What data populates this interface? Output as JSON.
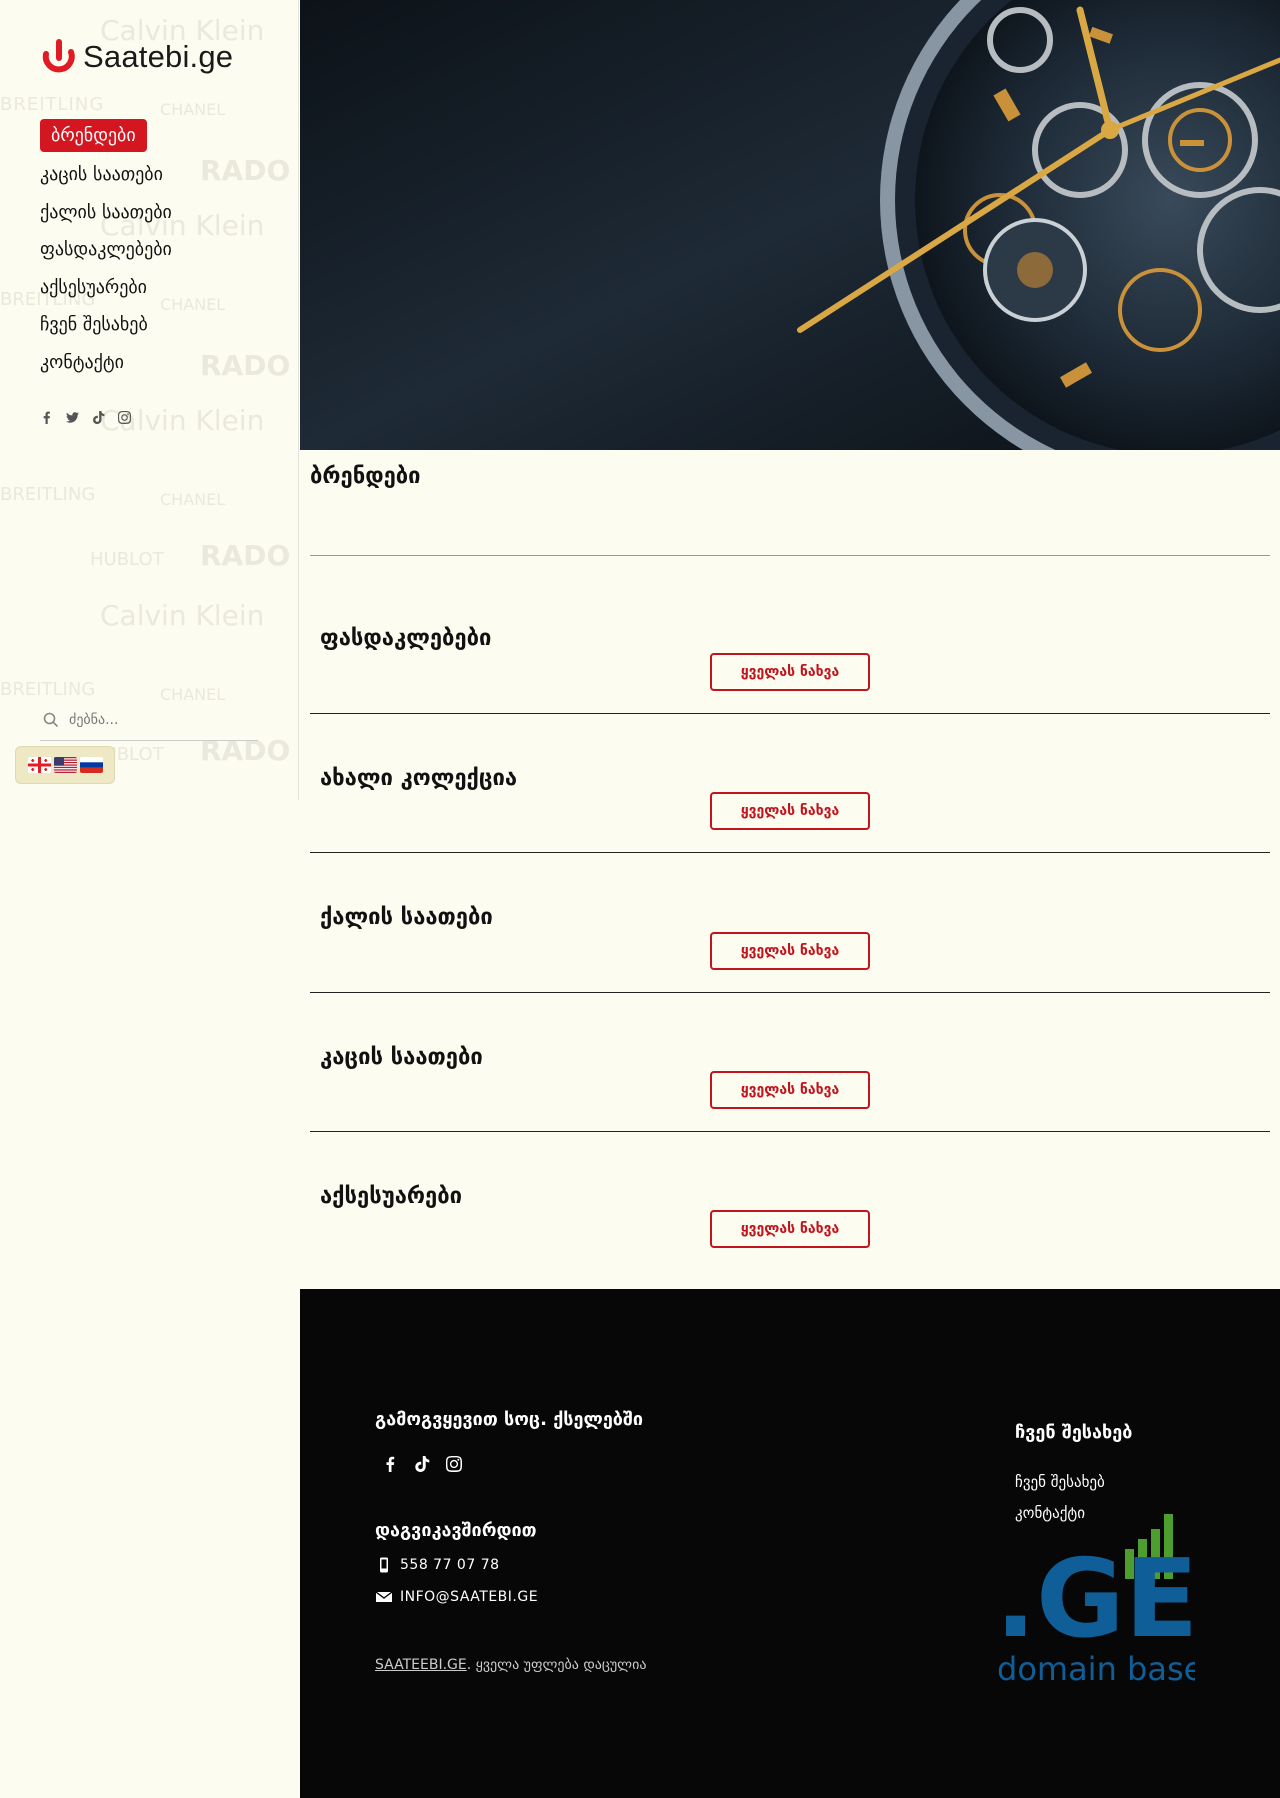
{
  "site": {
    "logo_text": "Saatebi.ge",
    "brand_color": "#d31620"
  },
  "sidebar": {
    "nav_items": [
      {
        "label": "ბრენდები",
        "active": true
      },
      {
        "label": "კაცის საათები"
      },
      {
        "label": "ქალის საათები"
      },
      {
        "label": "ფასდაკლებები"
      },
      {
        "label": "აქსესუარები"
      },
      {
        "label": "ჩვენ შესახებ"
      },
      {
        "label": "კონტაქტი"
      }
    ],
    "social_icons": [
      "facebook-icon",
      "twitter-icon",
      "tiktok-icon",
      "instagram-icon"
    ],
    "search_placeholder": "ძებნა...",
    "languages": [
      "georgian-flag",
      "us-flag",
      "russian-flag"
    ],
    "background_brands": [
      "Calvin Klein",
      "BREITLING",
      "CHANEL",
      "RADO",
      "HUBLOT"
    ]
  },
  "main": {
    "page_title": "ბრენდები",
    "sections": [
      {
        "title": "ფასდაკლებები",
        "button": "ყველას ნახვა"
      },
      {
        "title": "ახალი კოლექცია",
        "button": "ყველას ნახვა"
      },
      {
        "title": "ქალის საათები",
        "button": "ყველას ნახვა"
      },
      {
        "title": "კაცის საათები",
        "button": "ყველას ნახვა"
      },
      {
        "title": "აქსესუარები",
        "button": "ყველას ნახვა"
      }
    ]
  },
  "footer": {
    "follow_heading": "გამოგვყევით სოც. ქსელებში",
    "social_icons": [
      "facebook-icon",
      "tiktok-icon",
      "instagram-icon"
    ],
    "contact_heading": "დაგვიკავშირდით",
    "phone": "558 77 07 78",
    "email": "INFO@SAATEBI.GE",
    "copyright_link": "SAATEEBI.GE",
    "copyright_text": ". ყველა უფლება დაცულია",
    "about_heading": "ჩვენ შესახებ",
    "links": [
      "ჩვენ შესახებ",
      "კონტაქტი"
    ],
    "domain_logo_main": ".GE",
    "domain_logo_sub": "domain base"
  }
}
